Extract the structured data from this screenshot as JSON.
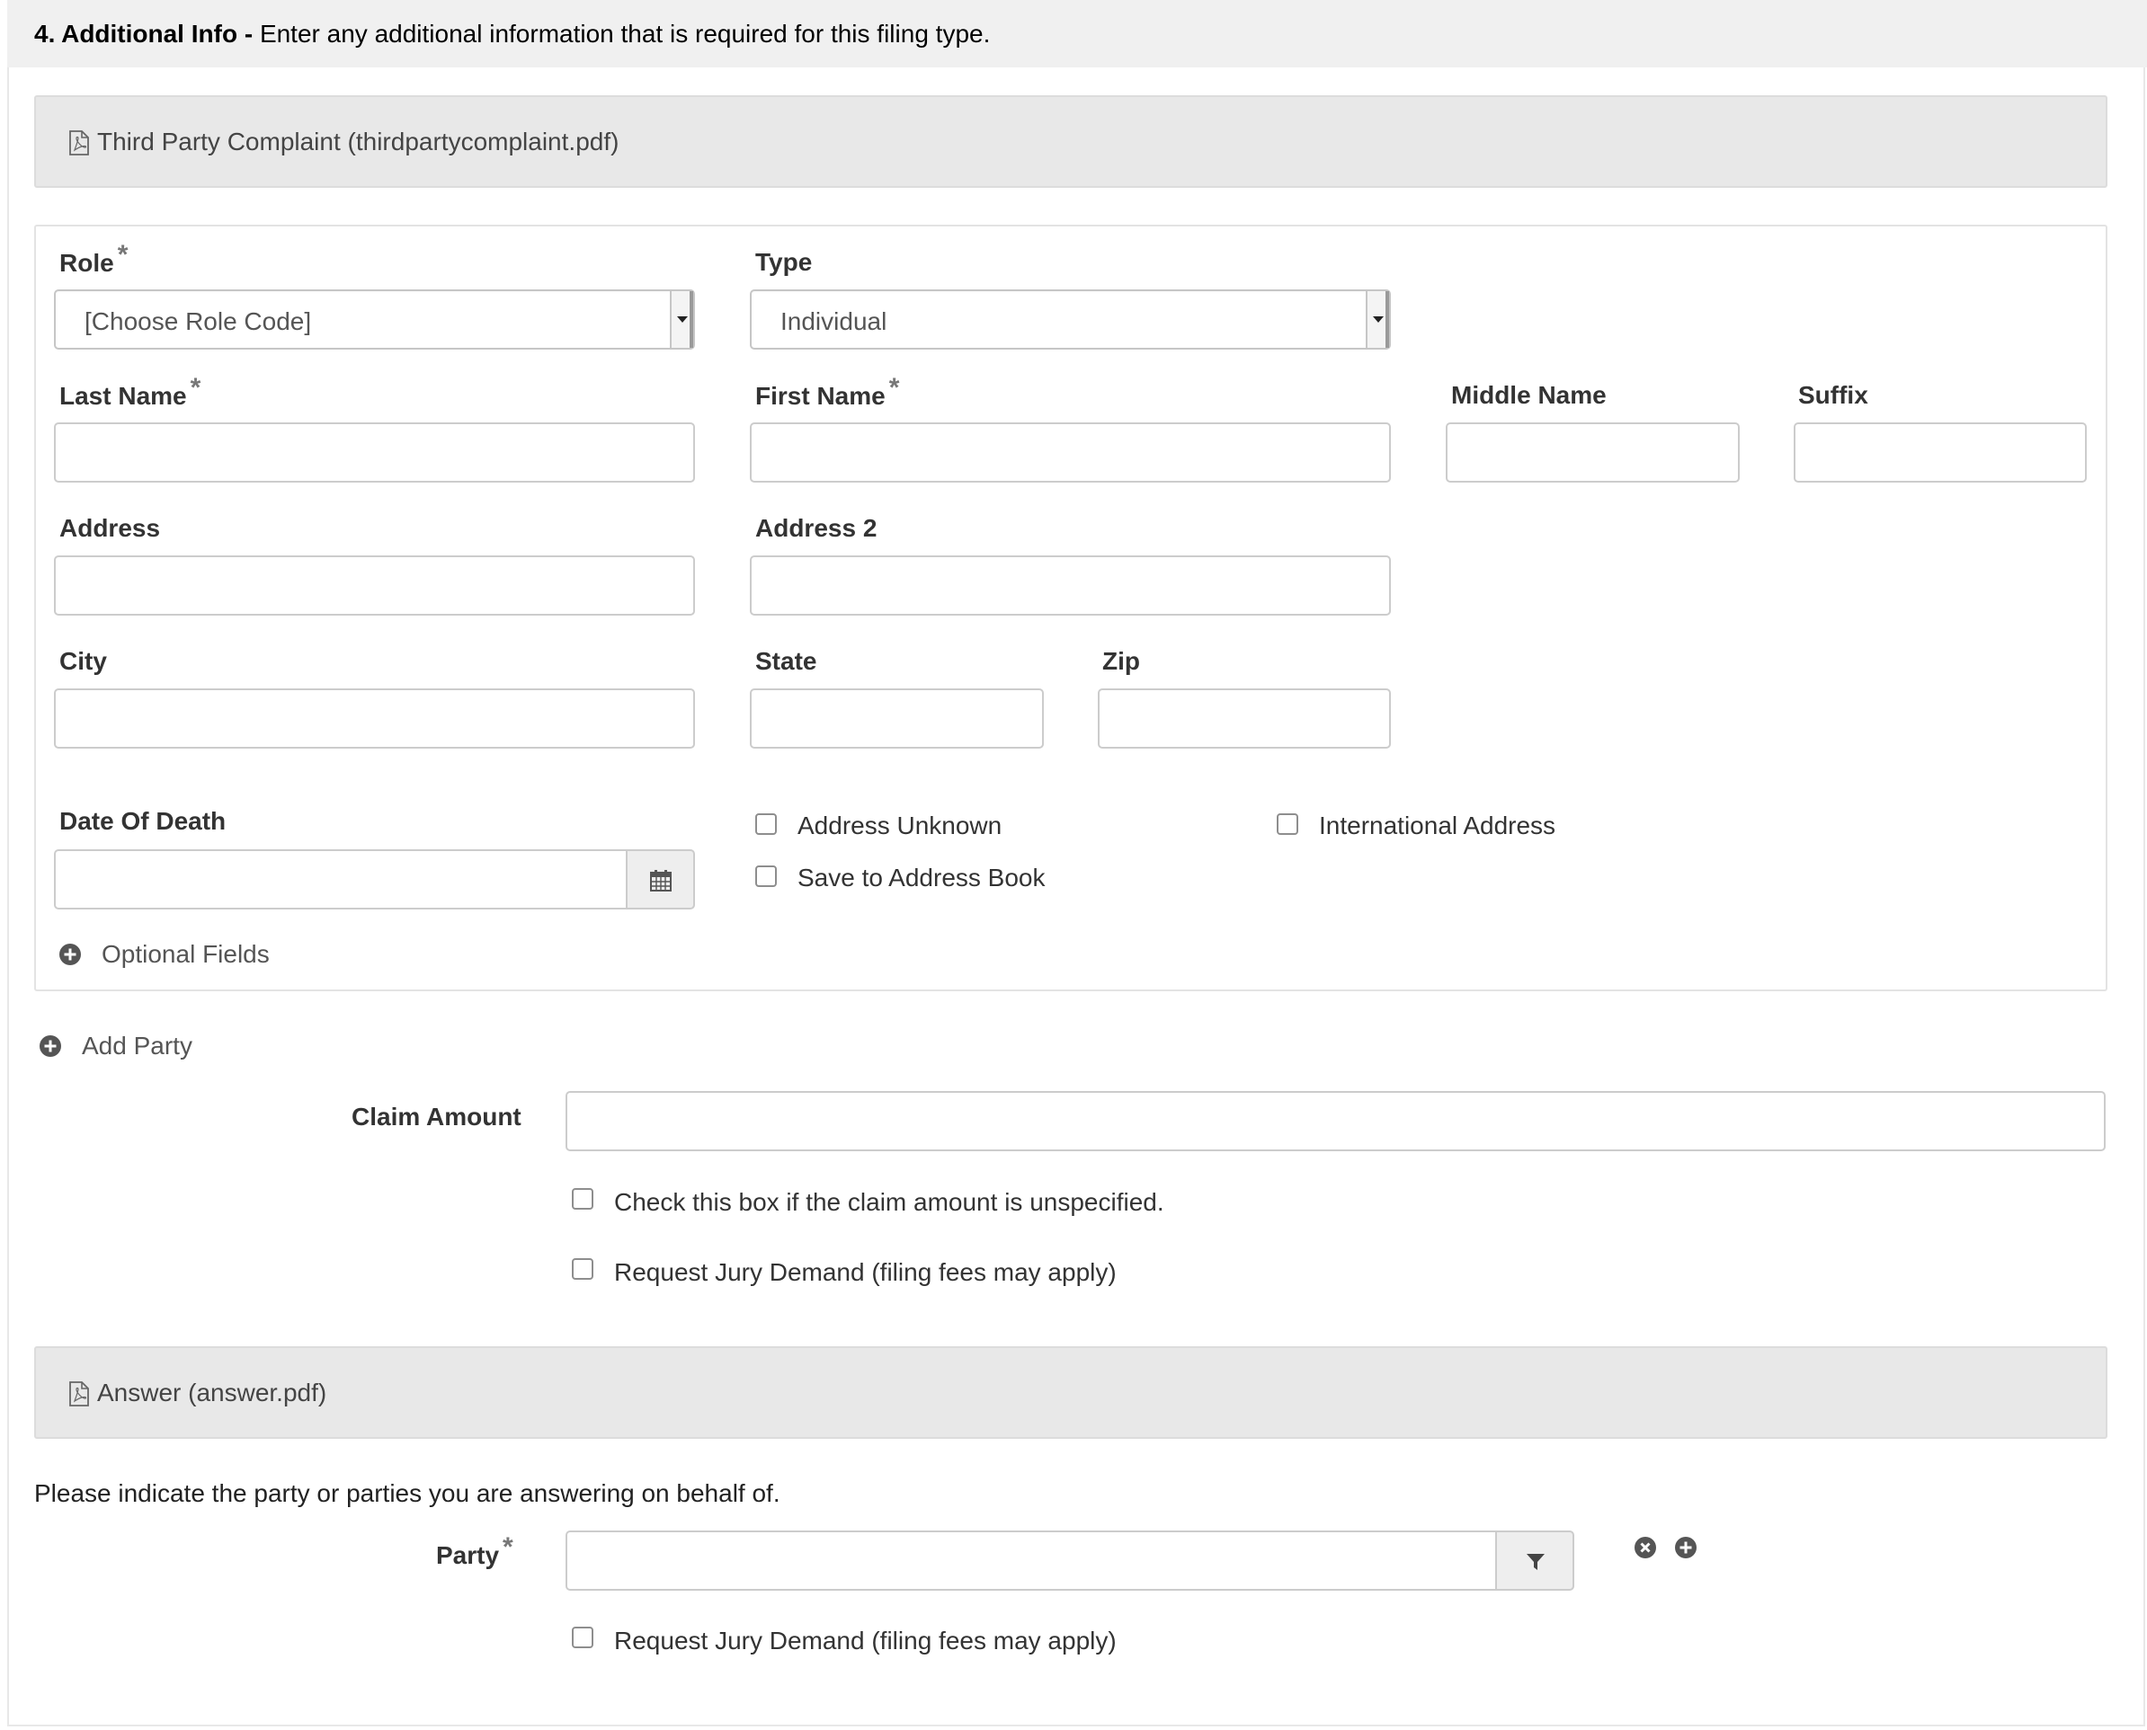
{
  "section": {
    "number_title": "4. Additional Info -",
    "description": "Enter any additional information that is required for this filing type."
  },
  "documents": [
    {
      "title": "Third Party Complaint (thirdpartycomplaint.pdf)",
      "icon": "pdf-file-icon"
    },
    {
      "title": "Answer (answer.pdf)",
      "icon": "pdf-file-icon"
    }
  ],
  "party_form": {
    "role": {
      "label": "Role",
      "required_mark": "*",
      "value": "[Choose Role Code]"
    },
    "type": {
      "label": "Type",
      "value": "Individual"
    },
    "last_name": {
      "label": "Last Name",
      "required_mark": "*",
      "value": ""
    },
    "first_name": {
      "label": "First Name",
      "required_mark": "*",
      "value": ""
    },
    "middle_name": {
      "label": "Middle Name",
      "value": ""
    },
    "suffix": {
      "label": "Suffix",
      "value": ""
    },
    "address": {
      "label": "Address",
      "value": ""
    },
    "address2": {
      "label": "Address 2",
      "value": ""
    },
    "city": {
      "label": "City",
      "value": ""
    },
    "state": {
      "label": "State",
      "value": ""
    },
    "zip": {
      "label": "Zip",
      "value": ""
    },
    "date_of_death": {
      "label": "Date Of Death",
      "value": "",
      "icon": "calendar-icon"
    },
    "address_unknown": {
      "label": "Address Unknown",
      "checked": false
    },
    "international_address": {
      "label": "International Address",
      "checked": false
    },
    "save_to_address_book": {
      "label": "Save to Address Book",
      "checked": false
    },
    "optional_fields": {
      "label": "Optional Fields",
      "icon": "plus-circle-icon"
    }
  },
  "add_party": {
    "label": "Add Party",
    "icon": "plus-circle-icon"
  },
  "claim": {
    "label": "Claim Amount",
    "value": "",
    "unspecified": {
      "label": "Check this box if the claim amount is unspecified.",
      "checked": false
    },
    "jury_demand": {
      "label": "Request Jury Demand (filing fees may apply)",
      "checked": false
    }
  },
  "answer": {
    "instruction": "Please indicate the party or parties you are answering on behalf of.",
    "party": {
      "label": "Party",
      "required_mark": "*",
      "value": "",
      "icon": "filter-icon"
    },
    "jury_demand": {
      "label": "Request Jury Demand (filing fees may apply)",
      "checked": false
    }
  },
  "colors": {
    "header_bg": "#f0f0f0",
    "doc_bar_bg": "#e8e8e8",
    "border": "#cccccc",
    "text": "#333333"
  }
}
